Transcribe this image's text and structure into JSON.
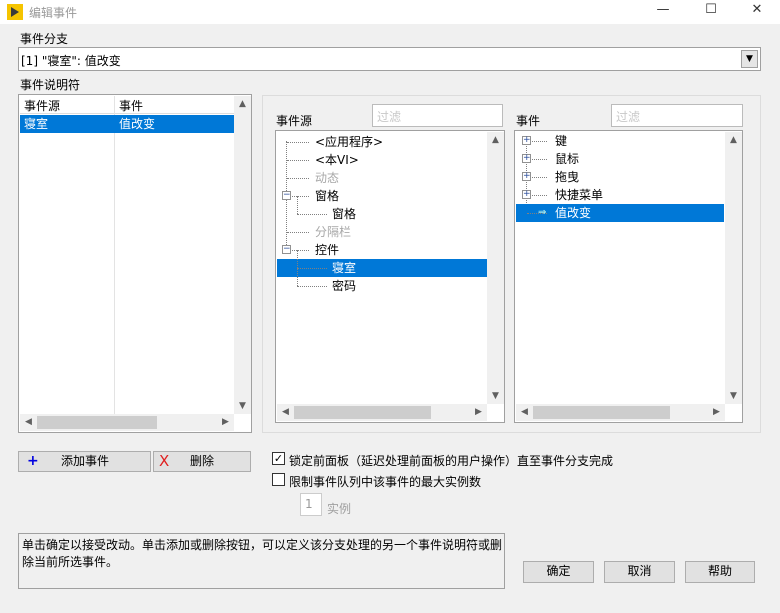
{
  "window": {
    "title": "编辑事件",
    "minimize": "—",
    "maximize": "☐",
    "close": "✕"
  },
  "case": {
    "label": "事件分支",
    "value": "[1] \"寝室\": 值改变"
  },
  "specifiers": {
    "label": "事件说明符",
    "columns": [
      "事件源",
      "事件"
    ],
    "rows": [
      {
        "source": "寝室",
        "event": "值改变",
        "selected": true
      }
    ]
  },
  "sources": {
    "label": "事件源",
    "filter_placeholder": "过滤",
    "items": [
      {
        "label": "<应用程序>",
        "level": 0,
        "disabled": false
      },
      {
        "label": "<本VI>",
        "level": 0,
        "disabled": false
      },
      {
        "label": "动态",
        "level": 0,
        "disabled": true
      },
      {
        "label": "窗格",
        "level": 0,
        "disabled": false,
        "expander": "−"
      },
      {
        "label": "窗格",
        "level": 1,
        "disabled": false
      },
      {
        "label": "分隔栏",
        "level": 0,
        "disabled": true
      },
      {
        "label": "控件",
        "level": 0,
        "disabled": false,
        "expander": "−"
      },
      {
        "label": "寝室",
        "level": 1,
        "disabled": false,
        "selected": true
      },
      {
        "label": "密码",
        "level": 1,
        "disabled": false
      }
    ]
  },
  "events": {
    "label": "事件",
    "filter_placeholder": "过滤",
    "items": [
      {
        "label": "键",
        "expander": "+"
      },
      {
        "label": "鼠标",
        "expander": "+"
      },
      {
        "label": "拖曳",
        "expander": "+"
      },
      {
        "label": "快捷菜单",
        "expander": "+"
      },
      {
        "label": "值改变",
        "selected": true,
        "marker": "⇒"
      }
    ]
  },
  "buttons": {
    "add": "添加事件",
    "add_icon": "+",
    "delete": "删除",
    "delete_icon": "X",
    "ok": "确定",
    "cancel": "取消",
    "help": "帮助"
  },
  "options": {
    "lock_panel": "锁定前面板（延迟处理前面板的用户操作）直至事件分支完成",
    "lock_checked": true,
    "limit_queue": "限制事件队列中该事件的最大实例数",
    "limit_checked": false,
    "instances_value": "1",
    "instances_label": "实例"
  },
  "help_text": "单击确定以接受改动。单击添加或删除按钮，可以定义该分支处理的另一个事件说明符或删除当前所选事件。",
  "colors": {
    "selection": "#0078d7",
    "logo": "#f5c400"
  }
}
